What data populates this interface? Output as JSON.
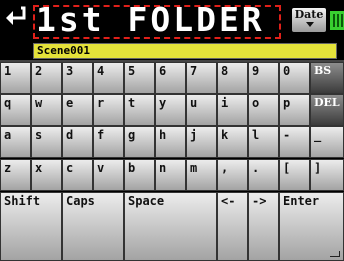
{
  "header": {
    "title": "1st FOLDER",
    "back_icon": "return-arrow-icon",
    "date_button_label": "Date",
    "battery_icon": "battery-icon"
  },
  "name_field": {
    "value": "Scene001"
  },
  "colors": {
    "background": "#000000",
    "name_field": "#e4e23a",
    "title_highlight_border": "#e0201a",
    "battery": "#38d030"
  },
  "keyboard": {
    "rows": [
      [
        "1",
        "2",
        "3",
        "4",
        "5",
        "6",
        "7",
        "8",
        "9",
        "0",
        "BS"
      ],
      [
        "q",
        "w",
        "e",
        "r",
        "t",
        "y",
        "u",
        "i",
        "o",
        "p",
        "DEL"
      ],
      [
        "a",
        "s",
        "d",
        "f",
        "g",
        "h",
        "j",
        "k",
        "l",
        "-",
        "_"
      ],
      [
        "z",
        "x",
        "c",
        "v",
        "b",
        "n",
        "m",
        ",",
        ".",
        "[",
        "]"
      ]
    ],
    "bottom_row": [
      "Shift",
      "Caps",
      "Space",
      "<-",
      "->",
      "Enter"
    ]
  }
}
